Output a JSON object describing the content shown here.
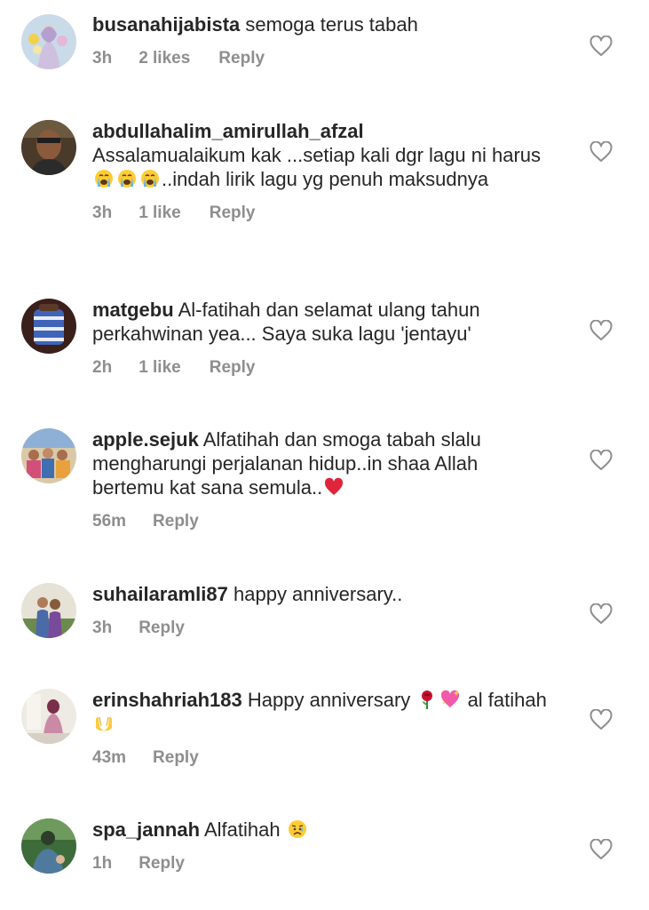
{
  "comments": [
    {
      "username": "busanahijabista",
      "text": "semoga terus tabah",
      "time": "3h",
      "likes": "2 likes",
      "reply": "Reply"
    },
    {
      "username": "abdullahalim_amirullah_afzal",
      "text_a": "Assalamualaikum kak ...setiap kali dgr lagu ni harus",
      "text_b": "..indah lirik lagu yg penuh maksudnya",
      "time": "3h",
      "likes": "1 like",
      "reply": "Reply"
    },
    {
      "username": "matgebu",
      "text": "Al-fatihah dan selamat ulang tahun perkahwinan yea... Saya suka lagu 'jentayu'",
      "time": "2h",
      "likes": "1 like",
      "reply": "Reply"
    },
    {
      "username": "apple.sejuk",
      "text": "Alfatihah dan smoga tabah slalu mengharungi perjalanan hidup..in shaa Allah bertemu kat sana semula..",
      "time": "56m",
      "reply": "Reply"
    },
    {
      "username": "suhailaramli87",
      "text": "happy anniversary..",
      "time": "3h",
      "reply": "Reply"
    },
    {
      "username": "erinshahriah183",
      "text_a": "Happy anniversary",
      "text_b": "al fatihah",
      "time": "43m",
      "reply": "Reply"
    },
    {
      "username": "spa_jannah",
      "text": "Alfatihah",
      "time": "1h",
      "reply": "Reply"
    }
  ],
  "icons": {
    "like": "heart-outline-icon",
    "crying": "loudly-crying-face-emoji",
    "red_heart": "red-heart-emoji",
    "rose": "rose-emoji",
    "sparkling_heart": "sparkling-heart-emoji",
    "raising_hands": "palms-up-together-emoji",
    "sad_face": "sad-but-relieved-face-emoji"
  },
  "colors": {
    "text": "#262626",
    "secondary": "#8e8e8e",
    "heart_stroke": "#8e8e8e"
  }
}
